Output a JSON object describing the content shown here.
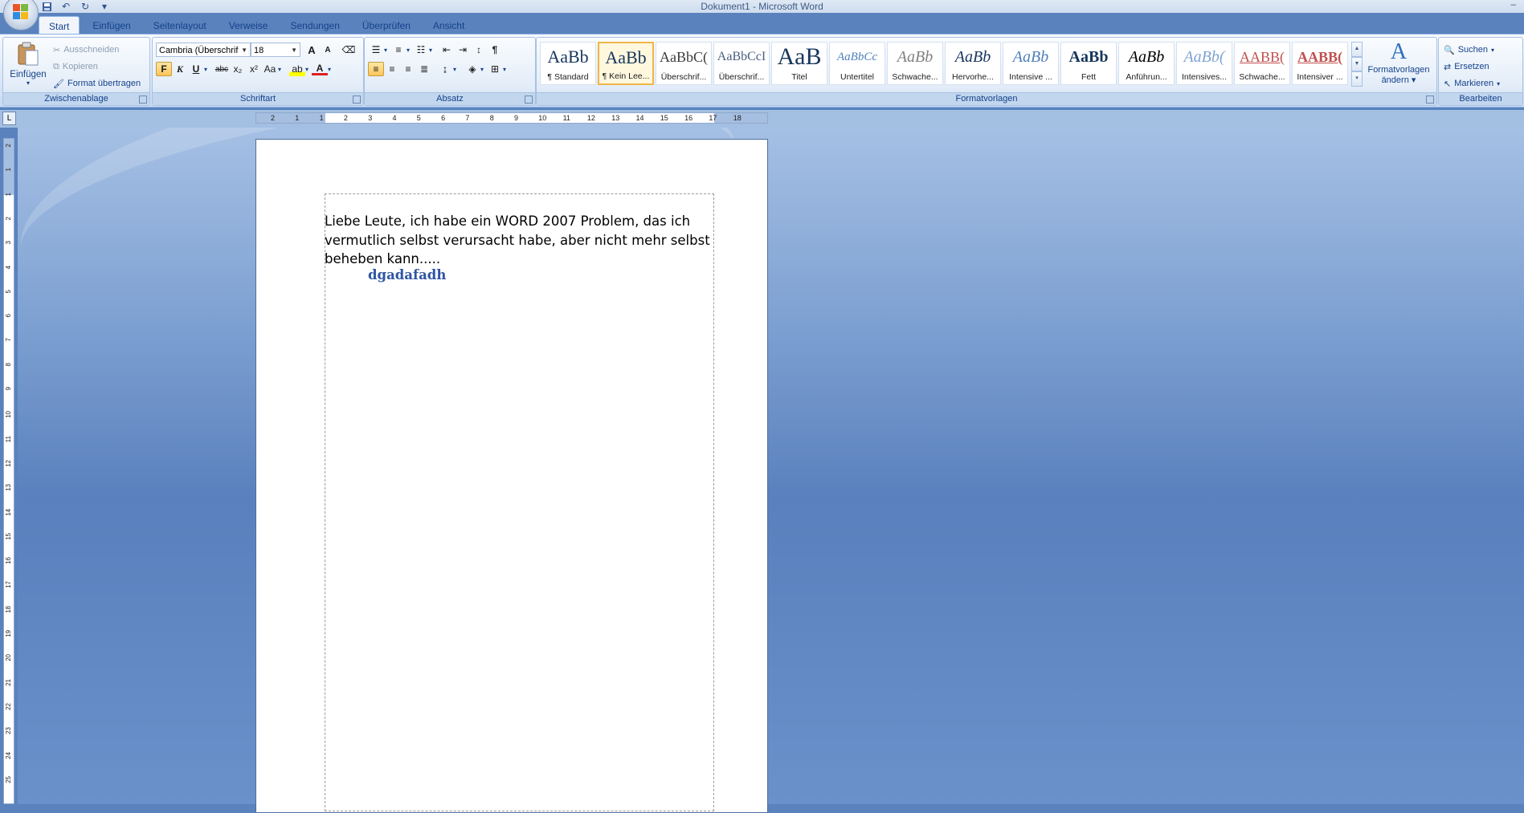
{
  "window": {
    "title": "Dokument1 - Microsoft Word",
    "controls": "–"
  },
  "qat": {
    "save_icon": "save-icon",
    "undo_icon": "undo-icon",
    "redo_icon": "redo-icon",
    "customize": "▾"
  },
  "tabs": [
    {
      "label": "Start",
      "active": true
    },
    {
      "label": "Einfügen"
    },
    {
      "label": "Seitenlayout"
    },
    {
      "label": "Verweise"
    },
    {
      "label": "Sendungen"
    },
    {
      "label": "Überprüfen"
    },
    {
      "label": "Ansicht"
    }
  ],
  "clipboard": {
    "group_label": "Zwischenablage",
    "paste_label": "Einfügen",
    "cut_label": "Ausschneiden",
    "copy_label": "Kopieren",
    "format_painter_label": "Format übertragen"
  },
  "font": {
    "group_label": "Schriftart",
    "font_name": "Cambria (Überschrif",
    "font_size": "18",
    "bold": "F",
    "italic": "K",
    "underline": "U",
    "strike": "abc",
    "subscript": "x₂",
    "superscript": "x²",
    "change_case": "Aa",
    "grow": "A",
    "shrink": "A"
  },
  "paragraph": {
    "group_label": "Absatz",
    "show_marks": "¶"
  },
  "styles": {
    "group_label": "Formatvorlagen",
    "items": [
      {
        "sample": "AaBb",
        "name": "¶ Standard"
      },
      {
        "sample": "AaBb",
        "name": "¶ Kein Lee...",
        "selected": true
      },
      {
        "sample": "AaBbC(",
        "name": "Überschrif..."
      },
      {
        "sample": "AaBbCcI",
        "name": "Überschrif..."
      },
      {
        "sample": "AaB",
        "name": "Titel"
      },
      {
        "sample": "AaBbCc",
        "name": "Untertitel"
      },
      {
        "sample": "AaBb",
        "name": "Schwache..."
      },
      {
        "sample": "AaBb",
        "name": "Hervorhe..."
      },
      {
        "sample": "AaBb",
        "name": "Intensive ..."
      },
      {
        "sample": "AaBb",
        "name": "Fett"
      },
      {
        "sample": "AaBb",
        "name": "Anführun..."
      },
      {
        "sample": "AaBb(",
        "name": "Intensives..."
      },
      {
        "sample": "AABB(",
        "name": "Schwache..."
      },
      {
        "sample": "AABB(",
        "name": "Intensiver ..."
      }
    ],
    "change_label_1": "Formatvorlagen",
    "change_label_2": "ändern"
  },
  "editing": {
    "group_label": "Bearbeiten",
    "find_label": "Suchen",
    "replace_label": "Ersetzen",
    "select_label": "Markieren"
  },
  "ruler": {
    "tab_selector": "L",
    "h_numbers": [
      "2",
      "1",
      "1",
      "2",
      "3",
      "4",
      "5",
      "6",
      "7",
      "8",
      "9",
      "10",
      "11",
      "12",
      "13",
      "14",
      "15",
      "16",
      "17",
      "18"
    ],
    "v_numbers": [
      "2",
      "1",
      "1",
      "2",
      "3",
      "4",
      "5",
      "6",
      "7",
      "8",
      "9",
      "10",
      "11",
      "12",
      "13",
      "14",
      "15",
      "16",
      "17",
      "18",
      "19",
      "20",
      "21",
      "22",
      "23",
      "24",
      "25"
    ]
  },
  "document": {
    "paragraph": "Liebe Leute, ich habe ein WORD 2007 Problem, das ich vermutlich selbst verursacht habe, aber nicht mehr selbst beheben kann.....",
    "heading": "dgadafadh"
  }
}
